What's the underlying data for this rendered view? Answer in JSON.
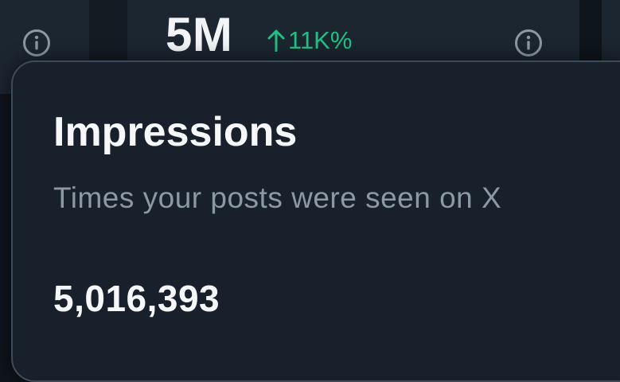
{
  "metric": {
    "value": "5M",
    "change": "11K%",
    "change_direction": "up",
    "change_color": "#22c084"
  },
  "icons": {
    "left_info": "info-icon",
    "right_info": "info-icon",
    "change_arrow": "arrow-up-icon"
  },
  "popover": {
    "title": "Impressions",
    "description": "Times your posts were seen on X",
    "value": "5,016,393"
  },
  "colors": {
    "background": "#0f151c",
    "card": "#1c2631",
    "popover": "#18212b",
    "popover_border": "#3d4b59",
    "text_primary": "#f5f7f9",
    "text_secondary": "#8b98a5"
  }
}
